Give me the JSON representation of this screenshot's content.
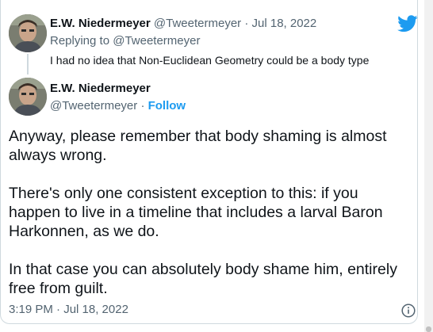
{
  "reply_tweet": {
    "author_name": "E.W. Niedermeyer",
    "author_handle": "@Tweetermeyer",
    "separator": "·",
    "date": "Jul 18, 2022",
    "replying_to": "Replying to @Tweetermeyer",
    "text": "I had no idea that Non-Euclidean Geometry could be a body type"
  },
  "main_tweet": {
    "author_name": "E.W. Niedermeyer",
    "author_handle": "@Tweetermeyer",
    "separator": "·",
    "follow_label": "Follow",
    "paragraphs": [
      "Anyway, please remember that body shaming is almost always wrong.",
      "There's only one consistent exception to this: if you happen to live in a timeline that includes a larval Baron Harkonnen, as we do.",
      "In that case you can absolutely body shame him, entirely free from guilt."
    ],
    "timestamp": "3:19 PM · Jul 18, 2022"
  },
  "icons": {
    "brand": "twitter-bird-icon",
    "info": "info-icon",
    "brand_color": "#1d9bf0",
    "muted_color": "#536471"
  }
}
